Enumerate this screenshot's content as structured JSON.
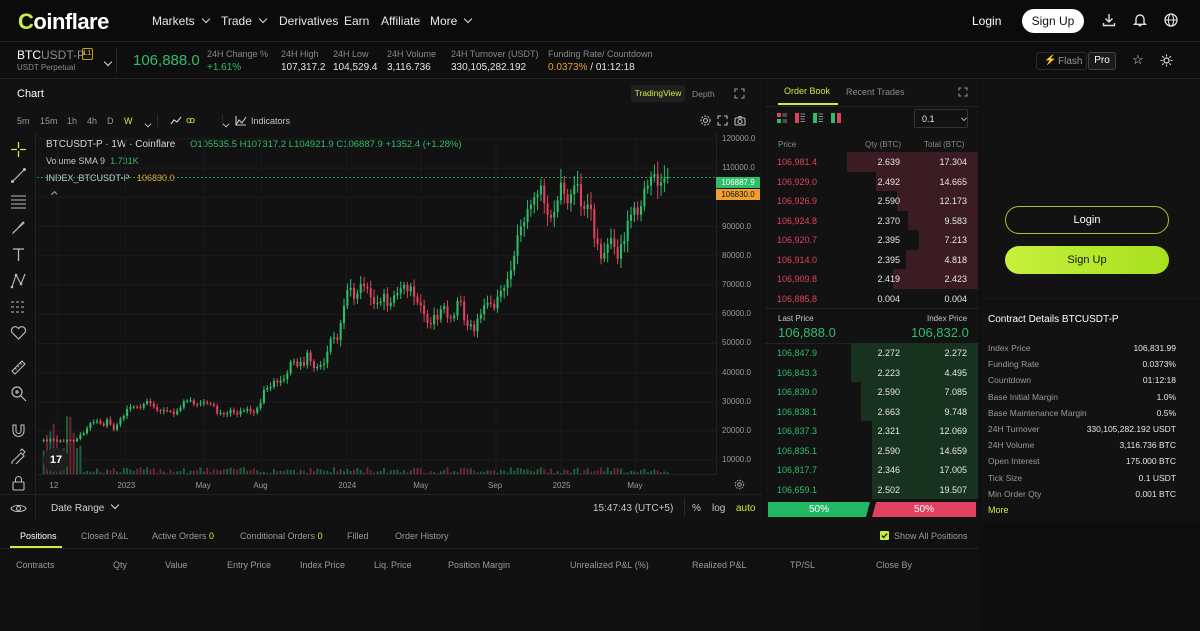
{
  "brand": {
    "name_prefix": "C",
    "name_rest": "oinflare"
  },
  "nav": {
    "items": [
      {
        "label": "Markets",
        "dropdown": true
      },
      {
        "label": "Trade",
        "dropdown": true
      },
      {
        "label": "Derivatives",
        "dropdown": false
      },
      {
        "label": "Earn",
        "dropdown": false
      },
      {
        "label": "Affiliate",
        "dropdown": false
      },
      {
        "label": "More",
        "dropdown": true
      }
    ],
    "login": "Login",
    "signup": "Sign Up"
  },
  "ticker": {
    "symbol_base": "BTC",
    "symbol_rest": "USDT-P",
    "badge": "L1",
    "subtitle": "USDT Perpetual",
    "last_price": "106,888.0",
    "change_label": "24H Change %",
    "change_value": "+1.61%",
    "high_label": "24H High",
    "high_value": "107,317.2",
    "low_label": "24H Low",
    "low_value": "104,529.4",
    "volume_label": "24H Volume",
    "volume_value": "3,116.736",
    "turnover_label": "24H Turnover (USDT)",
    "turnover_value": "330,105,282.192",
    "funding_label": "Funding Rate/ Countdown",
    "funding_rate": "0.0373%",
    "funding_countdown": "/ 01:12:18",
    "flash_label": "Flash",
    "pro_label": "Pro"
  },
  "chart_panel": {
    "title": "Chart",
    "tab_tradingview": "TradingView",
    "tab_depth": "Depth",
    "timeframes": [
      "5m",
      "15m",
      "1h",
      "4h",
      "D",
      "W"
    ],
    "active_timeframe": "W",
    "indicators_label": "Indicators",
    "legend_title": "BTCUSDT-P · 1W · Coinflare",
    "ohlc_o": "O105535.5",
    "ohlc_h": "H107317.2",
    "ohlc_l": "L104921.9",
    "ohlc_c": "C106887.9",
    "ohlc_chg": "+1352.4 (+1.28%)",
    "volume_label": "Volume SMA 9",
    "volume_value": "1.731K",
    "index_label": "INDEX_BTCUSDT-P",
    "index_value": "106830.0",
    "price_tag_last": "106887.9",
    "price_tag_index": "106830.0",
    "date_range": "Date Range",
    "time_display": "15:47:43 (UTC+5)",
    "pct_toggle": "%",
    "log_toggle": "log",
    "auto_toggle": "auto",
    "y_ticks": [
      "120000.0",
      "110000.0",
      "100000.0",
      "90000.0",
      "80000.0",
      "70000.0",
      "60000.0",
      "50000.0",
      "40000.0",
      "30000.0",
      "20000.0",
      "10000.0"
    ],
    "x_ticks": [
      "12",
      "2023",
      "May",
      "Aug",
      "2024",
      "May",
      "Sep",
      "2025",
      "May"
    ]
  },
  "chart_data": {
    "type": "candlestick",
    "title": "BTCUSDT-P · 1W · Coinflare",
    "xlabel": "",
    "ylabel": "",
    "ylim": [
      5000,
      122000
    ],
    "x_ticks": [
      "12",
      "2023",
      "May",
      "Aug",
      "2024",
      "May",
      "Sep",
      "2025",
      "May"
    ],
    "close": [
      17000,
      16800,
      17200,
      16900,
      16600,
      16800,
      16700,
      17000,
      16900,
      16600,
      17300,
      18800,
      19300,
      21000,
      22800,
      23100,
      23500,
      22600,
      21800,
      24000,
      22300,
      20500,
      22200,
      24300,
      25200,
      27600,
      28300,
      28400,
      28300,
      28000,
      29300,
      30300,
      29500,
      28200,
      27100,
      26800,
      27200,
      26900,
      26700,
      25800,
      27000,
      28100,
      30200,
      30400,
      30600,
      29300,
      29200,
      29500,
      29900,
      29500,
      29200,
      28600,
      26100,
      26200,
      25900,
      26100,
      27300,
      26300,
      25800,
      26900,
      27000,
      27600,
      26700,
      26300,
      28000,
      29700,
      34200,
      34700,
      35100,
      37200,
      36600,
      37300,
      37800,
      39800,
      43700,
      43900,
      42200,
      43700,
      42500,
      46900,
      43900,
      41600,
      42000,
      42700,
      43200,
      47200,
      51600,
      52100,
      51200,
      57000,
      62900,
      68300,
      69000,
      65300,
      67200,
      70400,
      69500,
      68900,
      65800,
      63500,
      63800,
      64300,
      67000,
      62800,
      63900,
      66400,
      67200,
      68800,
      70000,
      67800,
      69500,
      66000,
      64000,
      63000,
      60000,
      57000,
      56600,
      59700,
      58200,
      61700,
      62800,
      58900,
      58600,
      59500,
      64600,
      64300,
      58000,
      55900,
      56500,
      54200,
      58500,
      60000,
      63000,
      64000,
      63500,
      62000,
      66000,
      68000,
      69000,
      72000,
      75000,
      80000,
      87000,
      90000,
      91500,
      96000,
      97500,
      100000,
      101000,
      104000,
      98000,
      94000,
      93000,
      95000,
      99000,
      105000,
      101000,
      98000,
      101000,
      104000,
      104500,
      97000,
      96000,
      97500,
      96000,
      86000,
      84000,
      79000,
      81000,
      84000,
      86000,
      83000,
      79000,
      84000,
      85000,
      92000,
      94000,
      96500,
      94000,
      97000,
      103000,
      104000,
      107000,
      108000,
      104000,
      105000,
      106500,
      106888
    ]
  },
  "orderbook": {
    "tab_active": "Order Book",
    "tab_other": "Recent Trades",
    "precision": "0.1",
    "col_price": "Price",
    "col_qty": "Qty (BTC)",
    "col_total": "Total (BTC)",
    "asks": [
      {
        "price": "106,981.4",
        "qty": "2.639",
        "total": "17.304",
        "depth": 0.62
      },
      {
        "price": "106,929.0",
        "qty": "2.492",
        "total": "14.665",
        "depth": 0.48
      },
      {
        "price": "106,926.9",
        "qty": "2.590",
        "total": "12.173",
        "depth": 0.38
      },
      {
        "price": "106,924.8",
        "qty": "2.370",
        "total": "9.583",
        "depth": 0.33
      },
      {
        "price": "106,920.7",
        "qty": "2.395",
        "total": "7.213",
        "depth": 0.28
      },
      {
        "price": "106,914.0",
        "qty": "2.395",
        "total": "4.818",
        "depth": 0.34
      },
      {
        "price": "106,909.8",
        "qty": "2.419",
        "total": "2.423",
        "depth": 0.4
      },
      {
        "price": "106,885.8",
        "qty": "0.004",
        "total": "0.004",
        "depth": 0.0
      }
    ],
    "last_price_label": "Last Price",
    "last_price": "106,888.0",
    "index_price_label": "Index Price",
    "index_price": "106,832.0",
    "bids": [
      {
        "price": "106,847.9",
        "qty": "2.272",
        "total": "2.272",
        "depth": 0.6
      },
      {
        "price": "106,843.3",
        "qty": "2.223",
        "total": "4.495",
        "depth": 0.6
      },
      {
        "price": "106,839.0",
        "qty": "2.590",
        "total": "7.085",
        "depth": 0.55
      },
      {
        "price": "106,838.1",
        "qty": "2.663",
        "total": "9.748",
        "depth": 0.55
      },
      {
        "price": "106,837.3",
        "qty": "2.321",
        "total": "12.069",
        "depth": 0.5
      },
      {
        "price": "106,835.1",
        "qty": "2.590",
        "total": "14.659",
        "depth": 0.5
      },
      {
        "price": "106,817.7",
        "qty": "2.346",
        "total": "17.005",
        "depth": 0.5
      },
      {
        "price": "106,659.1",
        "qty": "2.502",
        "total": "19.507",
        "depth": 0.5
      }
    ],
    "buy_pct": "50%",
    "sell_pct": "50%"
  },
  "account": {
    "login": "Login",
    "signup": "Sign Up"
  },
  "contract": {
    "title": "Contract Details BTCUSDT-P",
    "rows": [
      {
        "k": "Index Price",
        "v": "106,831.99"
      },
      {
        "k": "Funding Rate",
        "v": "0.0373%"
      },
      {
        "k": "Countdown",
        "v": "01:12:18"
      },
      {
        "k": "Base Initial Margin",
        "v": "1.0%"
      },
      {
        "k": "Base Maintenance Margin",
        "v": "0.5%"
      },
      {
        "k": "24H Turnover",
        "v": "330,105,282.192 USDT"
      },
      {
        "k": "24H Volume",
        "v": "3,116.736 BTC"
      },
      {
        "k": "Open Interest",
        "v": "175.000 BTC"
      },
      {
        "k": "Tick Size",
        "v": "0.1 USDT"
      },
      {
        "k": "Min Order Qty",
        "v": "0.001 BTC"
      }
    ],
    "more": "More"
  },
  "positions": {
    "tabs": [
      {
        "label": "Positions",
        "count": ""
      },
      {
        "label": "Closed P&L",
        "count": ""
      },
      {
        "label": "Active Orders",
        "count": "0"
      },
      {
        "label": "Conditional Orders",
        "count": "0"
      },
      {
        "label": "Filled",
        "count": ""
      },
      {
        "label": "Order History",
        "count": ""
      }
    ],
    "show_all": "Show All Positions",
    "columns": [
      "Contracts",
      "Qty",
      "Value",
      "Entry Price",
      "Index Price",
      "Liq. Price",
      "Position Margin",
      "Unrealized P&L (%)",
      "Realized P&L",
      "TP/SL",
      "Close By"
    ]
  },
  "colors": {
    "accent": "#c6f03d",
    "up": "#2ebd6b",
    "down": "#e0415e",
    "bg": "#0e0e0e"
  }
}
